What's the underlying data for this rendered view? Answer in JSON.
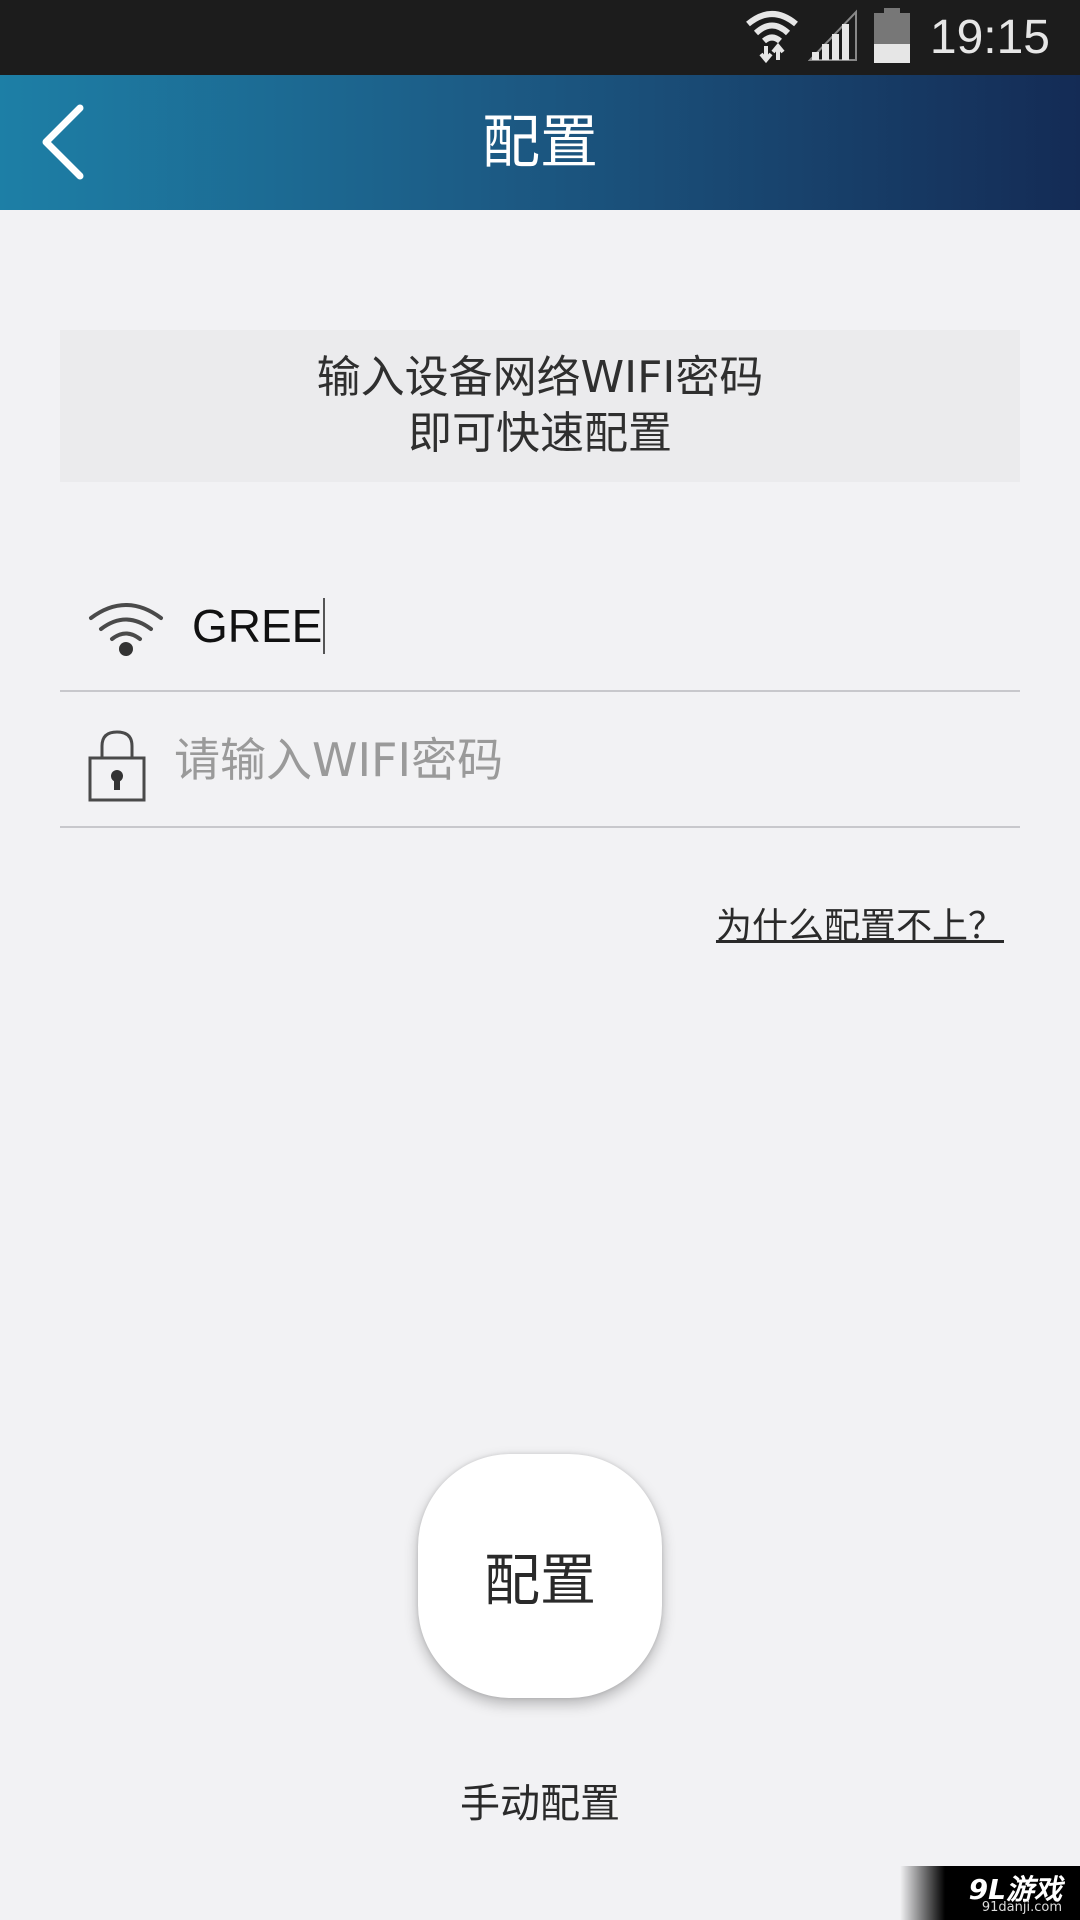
{
  "status_bar": {
    "time": "19:15",
    "icons": [
      "wifi-data-icon",
      "signal-icon",
      "battery-icon"
    ]
  },
  "app_bar": {
    "title": "配置",
    "back_icon": "chevron-left-icon"
  },
  "notice": {
    "line1": "输入设备网络WIFI密码",
    "line2": "即可快速配置"
  },
  "ssid_field": {
    "icon": "wifi-icon",
    "value": "GREE"
  },
  "password_field": {
    "icon": "lock-icon",
    "value": "",
    "placeholder": "请输入WIFI密码"
  },
  "help_link": "为什么配置不上？",
  "config_button": "配置",
  "manual_config": "手动配置",
  "watermark": {
    "brand": "9L游戏",
    "site": "91danji.com"
  },
  "colors": {
    "app_bar_start": "#1d7fa6",
    "app_bar_end": "#142b55",
    "background": "#f2f2f4"
  }
}
